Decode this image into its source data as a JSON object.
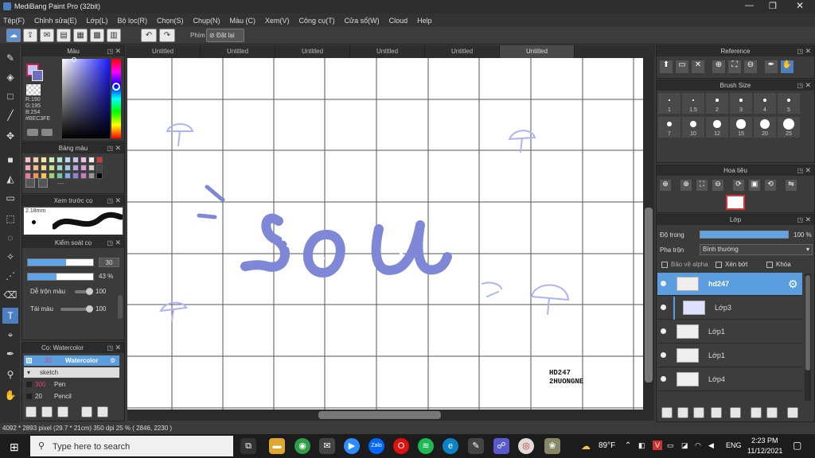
{
  "window": {
    "title": "MediBang Paint Pro (32bit)"
  },
  "menu": [
    "Tệp(F)",
    "Chỉnh sửa(E)",
    "Lớp(L)",
    "Bộ lọc(R)",
    "Chọn(S)",
    "Chụp(N)",
    "Màu (C)",
    "Xem(V)",
    "Công cụ(T)",
    "Cửa sổ(W)",
    "Cloud",
    "Help"
  ],
  "toolbar": {
    "phim_label": "Phím",
    "reset_label": "Đặt lại"
  },
  "tabs": [
    "Untitled",
    "Untitled",
    "Untitled",
    "Untitled",
    "Untitled",
    "Untitled"
  ],
  "color_panel": {
    "title": "Màu",
    "r": "R:190",
    "g": "G:195",
    "b": "B:254",
    "hex": "#BEC3FE"
  },
  "palette_panel": {
    "title": "Bảng màu",
    "more": "---"
  },
  "brush_preview": {
    "title": "Xem trước cọ",
    "size": "2.18mm"
  },
  "brush_control": {
    "title": "Kiểm soát cọ",
    "size_value": "30",
    "opacity_value": "43 %",
    "blend_label": "Dễ trộn màu",
    "blend_value": "100",
    "refill_label": "Tái màu",
    "refill_value": "100"
  },
  "brush_list": {
    "title": "Cọ: Watercolor",
    "items": [
      {
        "size": "30",
        "name": "Watercolor"
      },
      {
        "size": "",
        "name": "sketch"
      },
      {
        "size": "300",
        "name": "Pen"
      },
      {
        "size": "20",
        "name": "Pencil"
      }
    ]
  },
  "reference": {
    "title": "Reference"
  },
  "brush_size": {
    "title": "Brush Size",
    "row1": [
      "1",
      "1.5",
      "2",
      "3",
      "4",
      "5"
    ],
    "row2": [
      "7",
      "10",
      "12",
      "15",
      "20",
      "25"
    ]
  },
  "navigator": {
    "title": "Hoa tiêu"
  },
  "layer_panel": {
    "title": "Lớp",
    "opacity_label": "Độ trong",
    "opacity_value": "100 %",
    "blend_label": "Pha trộn",
    "blend_value": "Bình thường",
    "protect_alpha": "Bảo vệ alpha",
    "clipping": "Xén bớt",
    "lock": "Khóa",
    "layers": [
      "hd247",
      "Lớp3",
      "Lớp1",
      "Lớp1",
      "Lớp4"
    ]
  },
  "canvas": {
    "word": "sou",
    "watermark1": "HD247",
    "watermark2": "2HUONGNE"
  },
  "status": {
    "text": "4092 * 2893 pixel   (29.7 * 21cm)   350 dpi   25 %   ( 2846, 2230 )"
  },
  "taskbar": {
    "search_placeholder": "Type here to search",
    "weather": "89°F",
    "lang": "ENG",
    "time": "2:23 PM",
    "date": "11/12/2021"
  },
  "colors": {
    "accent": "#4c7fc2",
    "stroke": "#7f88d6",
    "canvas_bg": "#ffffff"
  }
}
